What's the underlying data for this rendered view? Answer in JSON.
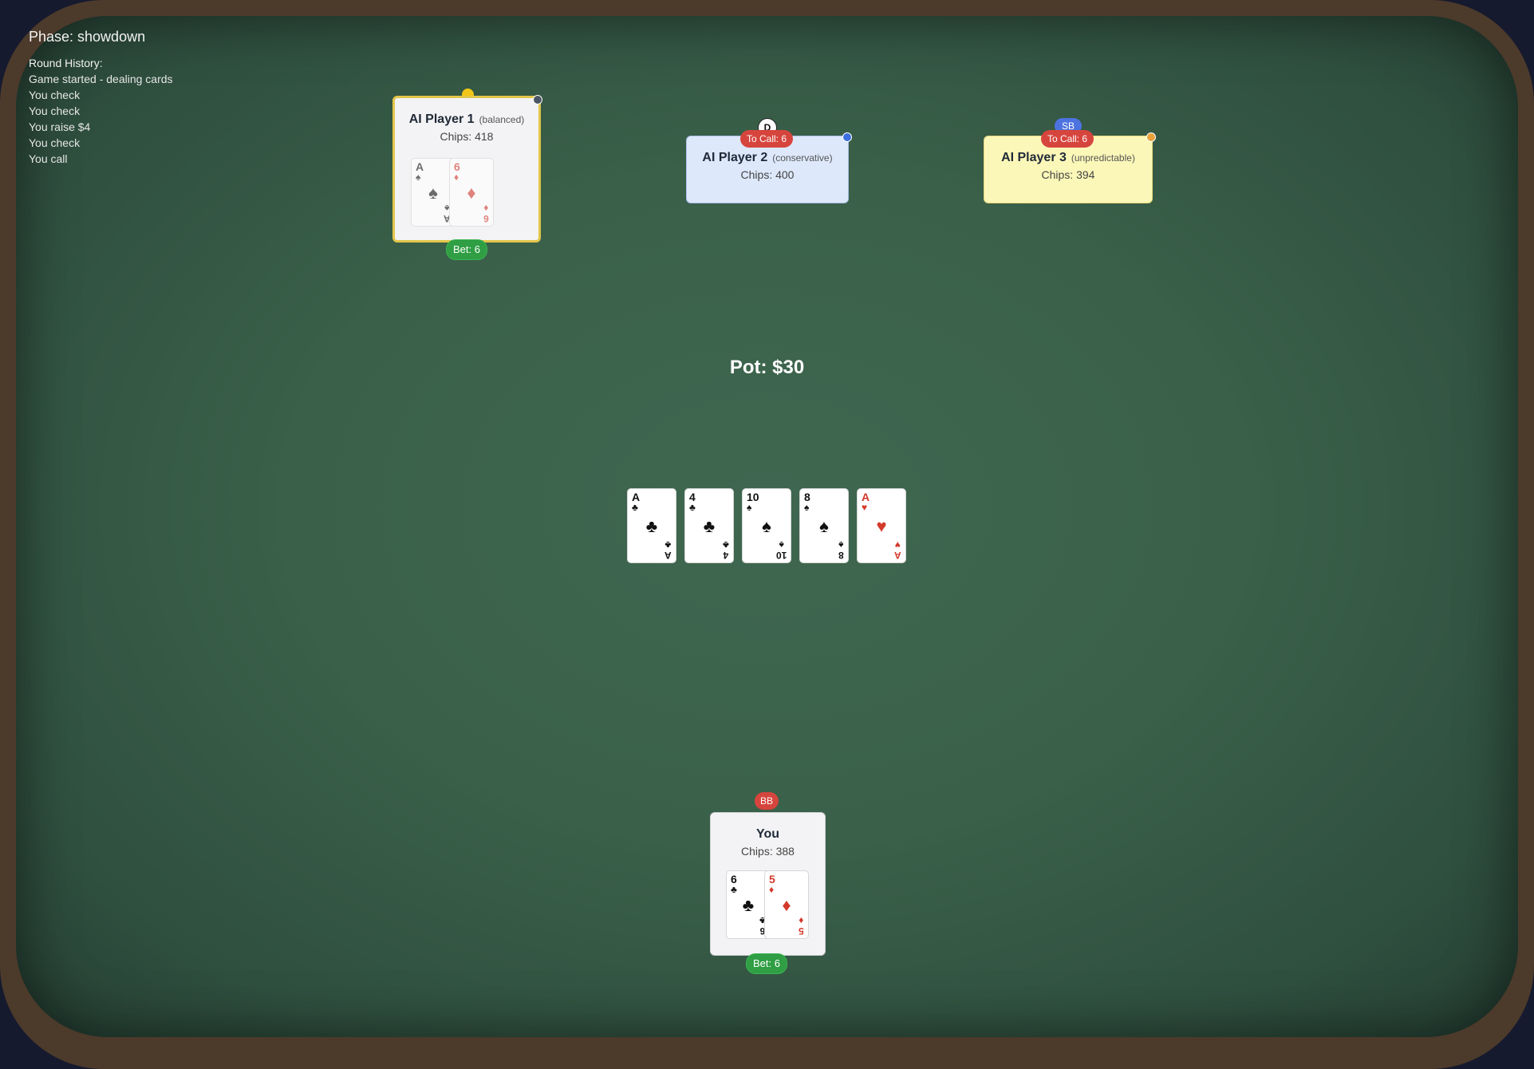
{
  "game": {
    "phase": "Phase: showdown",
    "pot": "Pot: $30"
  },
  "history": {
    "title": "Round History:",
    "items": [
      "Game started - dealing cards",
      "You check",
      "You check",
      "You raise $4",
      "You check",
      "You call"
    ]
  },
  "players": {
    "p1": {
      "name": "AI Player 1",
      "style": "(balanced)",
      "chips": "Chips: 418",
      "bet": "Bet: 6",
      "cards": [
        {
          "rank": "A",
          "suit": "♠"
        },
        {
          "rank": "6",
          "suit": "♦"
        }
      ]
    },
    "p2": {
      "name": "AI Player 2",
      "style": "(conservative)",
      "chips": "Chips: 400",
      "to_call": "To Call: 6",
      "dealer": "D"
    },
    "p3": {
      "name": "AI Player 3",
      "style": "(unpredictable)",
      "chips": "Chips: 394",
      "to_call": "To Call: 6",
      "blind": "SB"
    },
    "you": {
      "name": "You",
      "chips": "Chips: 388",
      "bet": "Bet: 6",
      "blind": "BB",
      "cards": [
        {
          "rank": "6",
          "suit": "♣"
        },
        {
          "rank": "5",
          "suit": "♦"
        }
      ]
    }
  },
  "community": [
    {
      "rank": "A",
      "suit": "♣"
    },
    {
      "rank": "4",
      "suit": "♣"
    },
    {
      "rank": "10",
      "suit": "♠"
    },
    {
      "rank": "8",
      "suit": "♠"
    },
    {
      "rank": "A",
      "suit": "♥"
    }
  ],
  "colors": {
    "felt": "#3a6049",
    "rim": "#4c3a2b",
    "active_border": "#e2c64a",
    "bet_green": "#2f9e44",
    "to_call_red": "#d6453d",
    "sb_blue": "#4d73e0",
    "suit_red": "#d33a2c"
  }
}
